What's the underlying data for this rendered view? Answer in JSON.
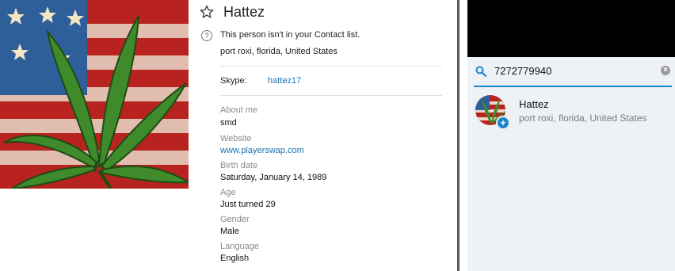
{
  "profile": {
    "name": "Hattez",
    "notice": "This person isn't in your Contact list.",
    "location": "port roxi, florida, United States",
    "skype_label": "Skype:",
    "skype_id": "hattez17",
    "fields": {
      "about_label": "About me",
      "about_value": "smd",
      "website_label": "Website",
      "website_value": "www.playerswap.com",
      "birth_label": "Birth date",
      "birth_value": "Saturday, January 14, 1989",
      "age_label": "Age",
      "age_value": "Just turned 29",
      "gender_label": "Gender",
      "gender_value": "Male",
      "language_label": "Language",
      "language_value": "English"
    },
    "icons": {
      "favorite": "star-icon",
      "info": "question-icon"
    }
  },
  "search": {
    "value": "7272779940",
    "icons": {
      "search": "search-icon",
      "clear": "clear-icon"
    }
  },
  "results": [
    {
      "name": "Hattez",
      "location": "port roxi, florida, United States",
      "status_icon": "plus-icon"
    }
  ],
  "colors": {
    "accent": "#1a86c8",
    "link": "#1a73b8",
    "panel_bg": "#eef1f6",
    "label_grey": "#8a8a8a"
  }
}
